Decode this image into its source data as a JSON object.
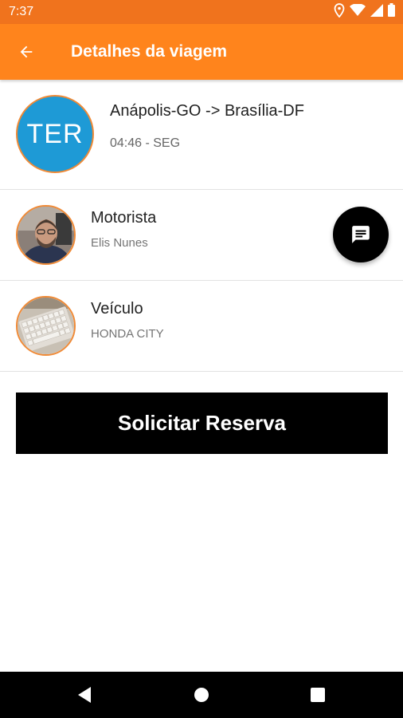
{
  "status_bar": {
    "time": "7:37",
    "icons": [
      "location-icon",
      "wifi-icon",
      "signal-icon",
      "battery-icon"
    ]
  },
  "app_bar": {
    "title": "Detalhes da viagem",
    "back_icon": "arrow-back-icon"
  },
  "trip": {
    "avatar_text": "TER",
    "route": "Anápolis-GO -> Brasília-DF",
    "time": "04:46 - SEG"
  },
  "driver": {
    "title": "Motorista",
    "name": "Elis Nunes"
  },
  "vehicle": {
    "title": "Veículo",
    "model": "HONDA CITY"
  },
  "chat_button": {
    "icon": "chat-icon"
  },
  "reserve_button": {
    "label": "Solicitar Reserva"
  },
  "nav_bar": {
    "icons": [
      "back-triangle-icon",
      "home-circle-icon",
      "recents-square-icon"
    ]
  },
  "colors": {
    "status_bar": "#f0731d",
    "app_bar": "#ff841c",
    "avatar_border": "#f08a36",
    "trip_avatar_bg": "#1e9ad6",
    "button_bg": "#000000"
  }
}
